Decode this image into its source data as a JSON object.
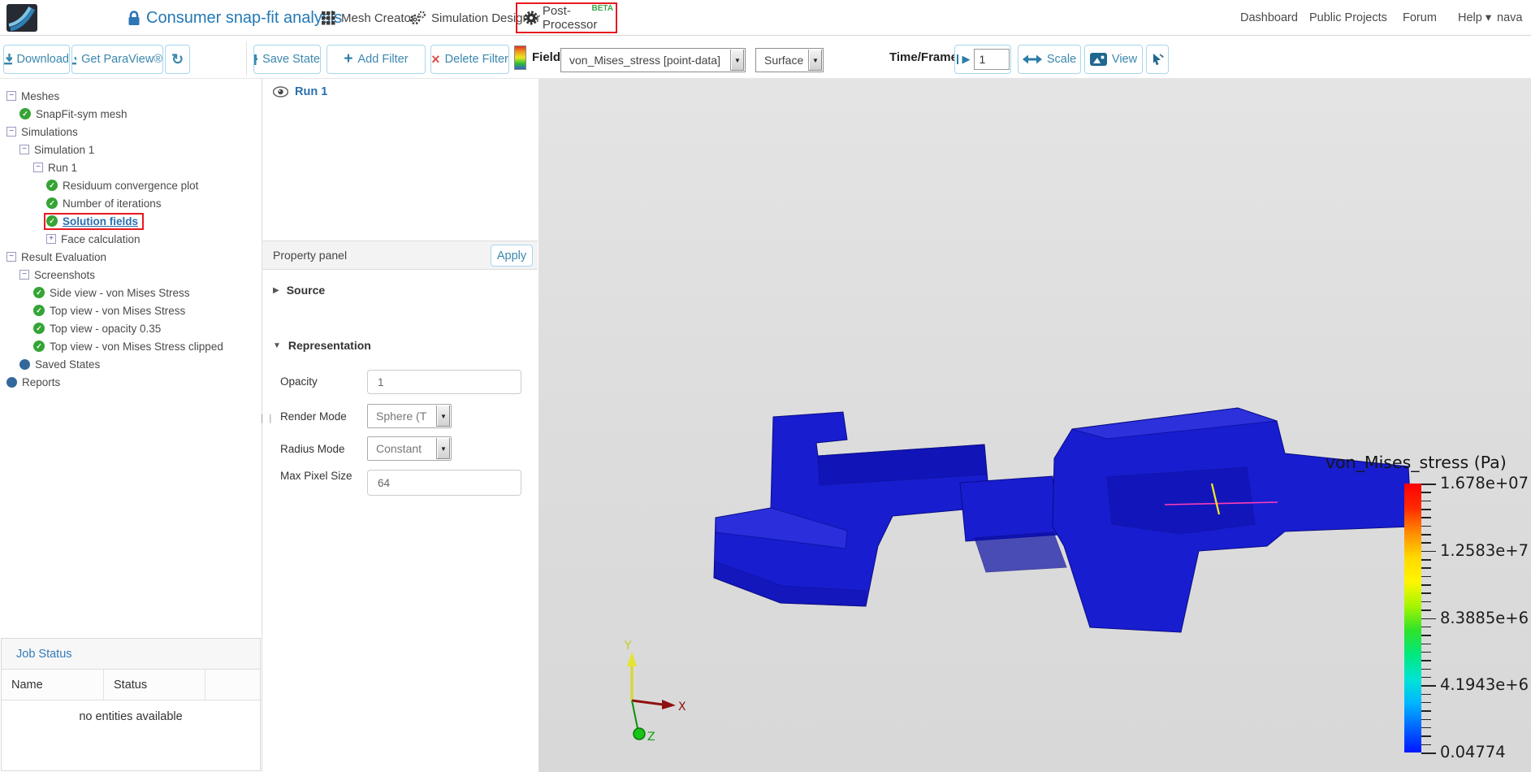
{
  "navbar": {
    "title": "Consumer snap-fit analysis",
    "tabs": [
      {
        "label": "Mesh Creator"
      },
      {
        "label": "Simulation Designer"
      },
      {
        "label": "Post-Processor",
        "beta": "BETA",
        "highlighted": true
      }
    ],
    "links": [
      "Dashboard",
      "Public Projects",
      "Forum",
      "Help"
    ],
    "user": "nava"
  },
  "left_toolbar": {
    "download": "Download",
    "get_paraview": "Get ParaView®"
  },
  "pp_toolbar": {
    "save_state": "Save State",
    "add_filter": "Add Filter",
    "delete_filter": "Delete Filter",
    "field_label": "Field:",
    "field_value": "von_Mises_stress [point-data]",
    "representation_value": "Surface",
    "time_frame_label": "Time/Frame:",
    "frame_value": "1",
    "scale": "Scale",
    "view": "View"
  },
  "icons": {
    "chevron_down": "▾",
    "refresh": "↻",
    "plus": "+",
    "cross": "×",
    "play": "▶",
    "section_collapsed": "▶",
    "section_expanded": "▼",
    "grip": "❘❘"
  },
  "tree": {
    "items": [
      {
        "label": "Meshes",
        "level": 0,
        "icon": "collapse"
      },
      {
        "label": "SnapFit-sym mesh",
        "level": 1,
        "icon": "check"
      },
      {
        "label": "Simulations",
        "level": 0,
        "icon": "collapse"
      },
      {
        "label": "Simulation 1",
        "level": 1,
        "icon": "collapse"
      },
      {
        "label": "Run 1",
        "level": 2,
        "icon": "collapse"
      },
      {
        "label": "Residuum convergence plot",
        "level": 3,
        "icon": "check"
      },
      {
        "label": "Number of iterations",
        "level": 3,
        "icon": "check"
      },
      {
        "label": "Solution fields",
        "level": 3,
        "icon": "check",
        "selected": true
      },
      {
        "label": "Face calculation",
        "level": 3,
        "icon": "expand"
      },
      {
        "label": "Result Evaluation",
        "level": 0,
        "icon": "collapse"
      },
      {
        "label": "Screenshots",
        "level": 1,
        "icon": "collapse"
      },
      {
        "label": "Side view - von Mises Stress",
        "level": 2,
        "icon": "check"
      },
      {
        "label": "Top view - von Mises Stress",
        "level": 2,
        "icon": "check"
      },
      {
        "label": "Top view - opacity 0.35",
        "level": 2,
        "icon": "check"
      },
      {
        "label": "Top view - von Mises Stress clipped",
        "level": 2,
        "icon": "check"
      },
      {
        "label": "Saved States",
        "level": 1,
        "icon": "dot"
      },
      {
        "label": "Reports",
        "level": 0,
        "icon": "dot"
      }
    ]
  },
  "job_status": {
    "title": "Job Status",
    "columns": [
      "Name",
      "Status",
      ""
    ],
    "empty_text": "no entities available"
  },
  "pipeline": {
    "item": "Run 1"
  },
  "property_panel": {
    "title": "Property panel",
    "apply": "Apply",
    "sections": [
      {
        "name": "Source",
        "collapsed": true
      },
      {
        "name": "Representation",
        "collapsed": false
      }
    ],
    "fields": [
      {
        "label": "Opacity",
        "type": "input",
        "value": "1"
      },
      {
        "label": "Render Mode",
        "type": "select",
        "value": "Sphere (T"
      },
      {
        "label": "Radius Mode",
        "type": "select",
        "value": "Constant"
      },
      {
        "label": "Max Pixel Size",
        "type": "input",
        "value": "64"
      }
    ]
  },
  "viewport": {
    "legend": {
      "title": "von_Mises_stress (Pa)",
      "tick_labels": [
        "1.678e+07",
        "1.2583e+7",
        "8.3885e+6",
        "4.1943e+6",
        "0.04774"
      ],
      "colormap": [
        "#fb0005",
        "#ff2a00",
        "#ff8a00",
        "#ffd800",
        "#fff600",
        "#a6f500",
        "#2fe32a",
        "#00e87e",
        "#00e4d4",
        "#00b4ff",
        "#0063ff",
        "#0016ff"
      ]
    },
    "axes": {
      "x": "X",
      "y": "Y",
      "z": "Z"
    },
    "model_color": "#181dcf",
    "probe_line_color": "#ff3db8",
    "probe_marker_color": "#ffe81e"
  },
  "colors": {
    "accent_blue": "#3a87ad",
    "link_blue": "#337ab7",
    "title_blue": "#2379b5",
    "check_green": "#35a435",
    "beta_green": "#3aa64a",
    "highlight_red": "#e8191f",
    "node_blue": "#33689b"
  }
}
